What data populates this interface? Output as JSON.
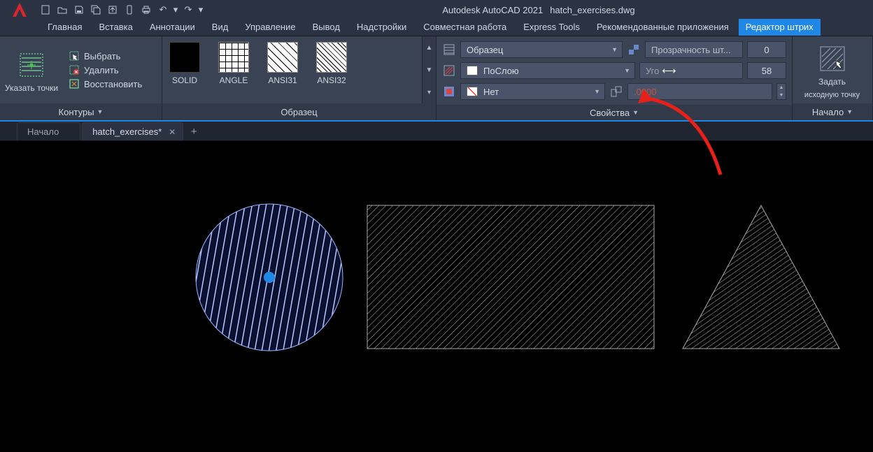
{
  "title": {
    "app": "Autodesk AutoCAD 2021",
    "file": "hatch_exercises.dwg"
  },
  "qat_icons": [
    "new-icon",
    "open-icon",
    "save-icon",
    "saveall-icon",
    "publish-icon",
    "mobile-icon",
    "print-icon",
    "undo-icon",
    "undo-dd-icon",
    "redo-icon",
    "redo-dd-icon"
  ],
  "menu": {
    "items": [
      "Главная",
      "Вставка",
      "Аннотации",
      "Вид",
      "Управление",
      "Вывод",
      "Надстройки",
      "Совместная работа",
      "Express Tools",
      "Рекомендованные приложения",
      "Редактор штрих"
    ],
    "active_index": 10
  },
  "ribbon": {
    "boundaries": {
      "pick_points": "Указать точки",
      "select": "Выбрать",
      "remove": "Удалить",
      "recreate": "Восстановить",
      "panel_title": "Контуры"
    },
    "pattern": {
      "items": [
        {
          "name": "SOLID",
          "style": "solid"
        },
        {
          "name": "ANGLE",
          "style": "angle"
        },
        {
          "name": "ANSI31",
          "style": "ansi31"
        },
        {
          "name": "ANSI32",
          "style": "ansi32"
        }
      ],
      "panel_title": "Образец"
    },
    "properties": {
      "pattern_mode": "Образец",
      "transparency_label": "Прозрачность шт...",
      "transparency_value": "0",
      "color": "ПоСлою",
      "angle_label": "Уго",
      "angle_value": "58",
      "bgcolor": "Нет",
      "scale_value": ".0000",
      "panel_title": "Свойства"
    },
    "origin": {
      "label_line1": "Задать",
      "label_line2": "исходную точку",
      "panel_title": "Начало"
    }
  },
  "doc_tabs": {
    "items": [
      {
        "label": "Начало",
        "active": false,
        "closable": false
      },
      {
        "label": "hatch_exercises*",
        "active": true,
        "closable": true
      }
    ]
  }
}
